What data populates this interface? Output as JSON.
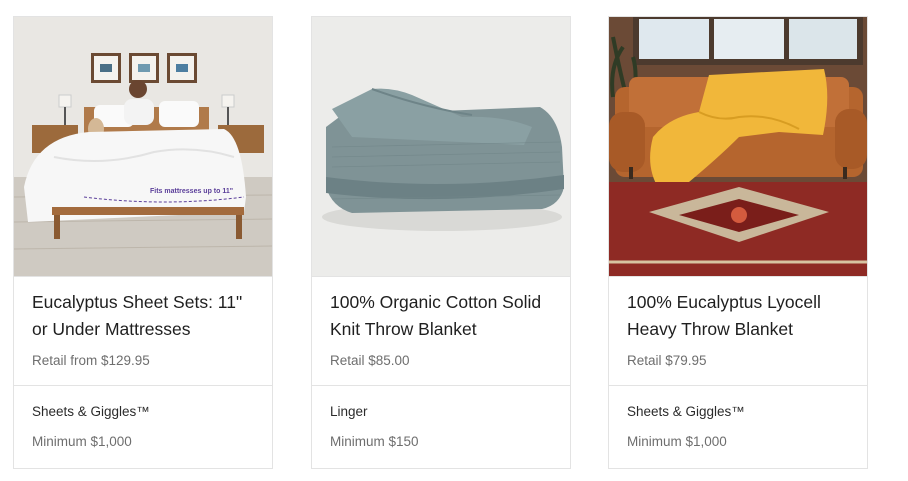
{
  "products": [
    {
      "title": "Eucalyptus Sheet Sets: 11\" or Under Mattresses",
      "retail": "Retail from $129.95",
      "brand": "Sheets & Giggles™",
      "minimum": "Minimum $1,000",
      "image_caption": "Fits mattresses up to 11\""
    },
    {
      "title": "100% Organic Cotton Solid Knit Throw Blanket",
      "retail": "Retail $85.00",
      "brand": "Linger",
      "minimum": "Minimum $150"
    },
    {
      "title": "100% Eucalyptus Lyocell Heavy Throw Blanket",
      "retail": "Retail $79.95",
      "brand": "Sheets & Giggles™",
      "minimum": "Minimum $1,000"
    }
  ],
  "colors": {
    "border": "#e3e3e3",
    "title_text": "#1f1f1f",
    "muted_text": "#6e6e6e",
    "caption_purple": "#5b3f9a"
  }
}
